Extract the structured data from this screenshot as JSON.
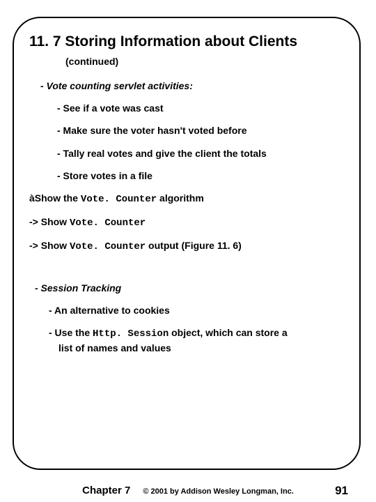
{
  "title": "11. 7 Storing Information about Clients",
  "continued": "(continued)",
  "lines": {
    "activities_heading": "- Vote counting servlet activities:",
    "a1": "- See if a vote was cast",
    "a2": "- Make sure the voter hasn't voted before",
    "a3": "- Tally real votes and give the client the totals",
    "a4": "- Store votes in a file",
    "show_algo_prefix": "à",
    "show_algo_1": "Show the ",
    "show_algo_code": "Vote. Counter",
    "show_algo_2": " algorithm",
    "show_vc_prefix": "-> Show ",
    "show_vc_code": "Vote. Counter",
    "show_out_prefix": "-> Show ",
    "show_out_code": "Vote. Counter",
    "show_out_suffix": " output (Figure 11. 6)",
    "session_heading": "- Session Tracking",
    "s1": "- An alternative to cookies",
    "s2a": "- Use the ",
    "s2code": "Http. Session",
    "s2b": " object, which can store a",
    "s2c": "list of names and values"
  },
  "footer": {
    "chapter": "Chapter 7",
    "copyright": "© 2001 by Addison Wesley Longman, Inc.",
    "page": "91"
  }
}
